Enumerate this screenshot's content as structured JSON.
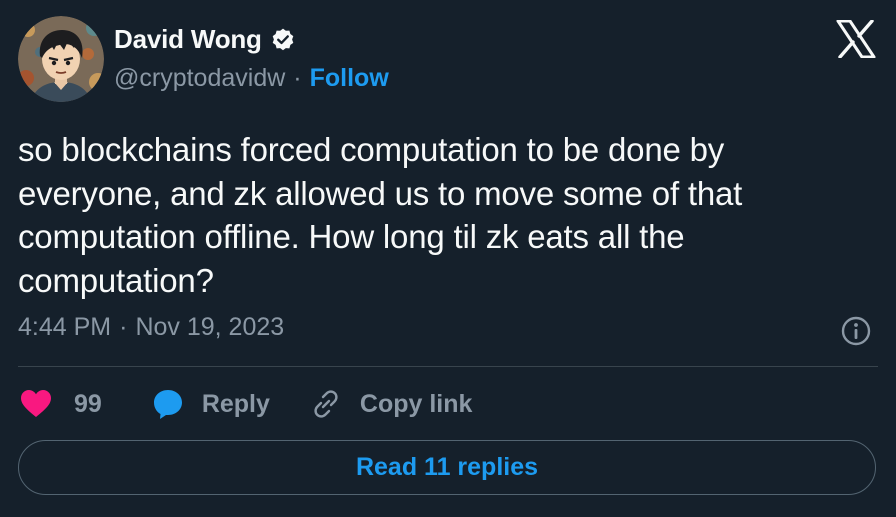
{
  "author": {
    "display_name": "David Wong",
    "handle": "@cryptodavidw",
    "verified": true,
    "avatar_icon": "avatar-illustration"
  },
  "header": {
    "separator": "·",
    "follow_label": "Follow",
    "x_logo_icon": "x-logo-icon"
  },
  "tweet": {
    "text": "so blockchains forced computation to be done by\neveryone, and zk allowed us to move some of that\ncomputation offline. How long til zk eats all the\ncomputation?",
    "time": "4:44 PM",
    "date": "Nov 19, 2023",
    "separator": "·"
  },
  "actions": {
    "like_count": "99",
    "reply_label": "Reply",
    "copy_link_label": "Copy link"
  },
  "footer": {
    "read_replies_label": "Read 11 replies"
  },
  "colors": {
    "background": "#15202b",
    "text_primary": "#f7f9f9",
    "text_secondary": "#8b98a5",
    "accent_blue": "#1d9bf0",
    "like_pink": "#f91880",
    "divider": "#38444d"
  }
}
